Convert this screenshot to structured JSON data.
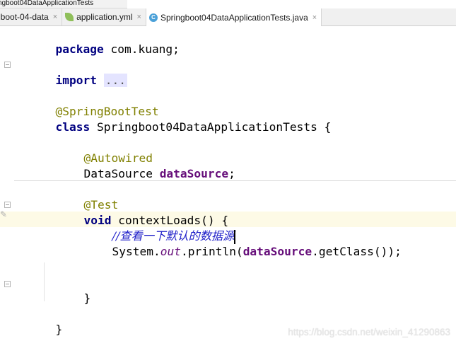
{
  "breadcrumb": "ngboot04DataApplicationTests",
  "tabs": [
    {
      "label": "gboot-04-data",
      "icon": "module-icon",
      "active": false
    },
    {
      "label": "application.yml",
      "icon": "spring-leaf-icon",
      "active": false
    },
    {
      "label": "Springboot04DataApplicationTests.java",
      "icon": "class-icon",
      "active": true
    }
  ],
  "tab_close_glyph": "×",
  "class_icon_letter": "C",
  "code": {
    "package_kw": "package",
    "package_name": " com.kuang;",
    "import_kw": "import",
    "import_folded": "...",
    "annotation_test_class": "@SpringBootTest",
    "class_kw": "class",
    "class_name": " Springboot04DataApplicationTests {",
    "annotation_autowired": "@Autowired",
    "field_type": "DataSource ",
    "field_name": "dataSource",
    "field_end": ";",
    "annotation_test": "@Test",
    "void_kw": "void",
    "method_sig": " contextLoads() {",
    "comment": "//查看一下默认的数据源",
    "print_system": "System.",
    "print_out": "out",
    "print_call": ".println(",
    "print_arg": "dataSource",
    "print_end": ".getClass());",
    "method_close": "}",
    "class_close": "}"
  },
  "watermark": "https://blog.csdn.net/weixin_41290863",
  "colors": {
    "keyword": "#000080",
    "annotation": "#808000",
    "field": "#660e7a",
    "comment": "#1c1cc8"
  }
}
